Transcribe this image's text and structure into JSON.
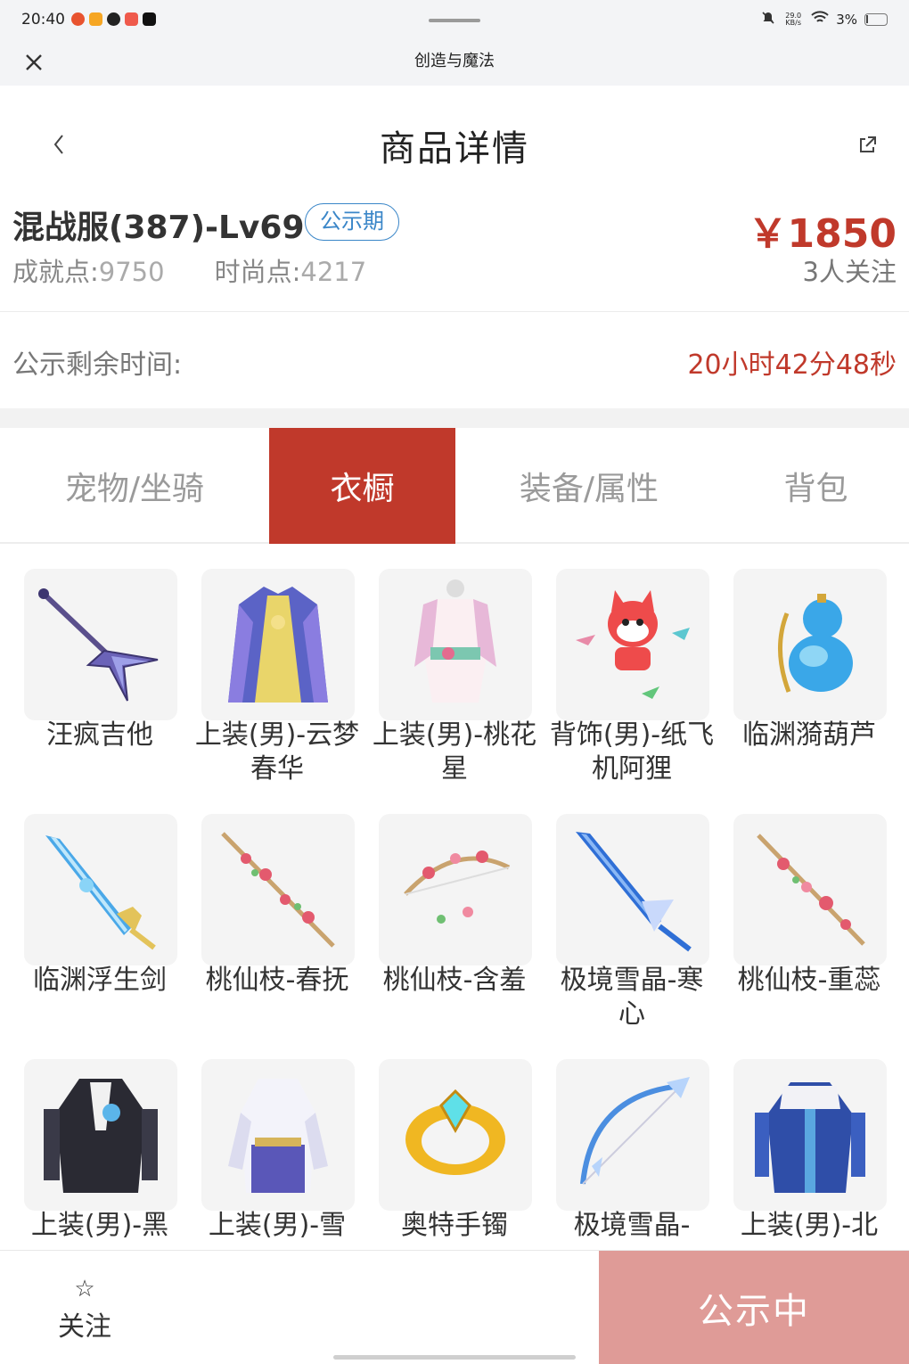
{
  "status_bar": {
    "time": "20:40",
    "net_speed": "29.0 KB/s",
    "battery": "3%"
  },
  "app_bar": {
    "title": "创造与魔法"
  },
  "header": {
    "title": "商品详情"
  },
  "product": {
    "name": "混战服(387)-Lv69",
    "badge": "公示期",
    "achievement_label": "成就点:",
    "achievement_value": "9750",
    "fashion_label": "时尚点:",
    "fashion_value": "4217",
    "price": "￥1850",
    "followers": "3人关注"
  },
  "countdown": {
    "label": "公示剩余时间:",
    "value": "20小时42分48秒"
  },
  "tabs": [
    {
      "label": "宠物/坐骑",
      "active": false
    },
    {
      "label": "衣橱",
      "active": true
    },
    {
      "label": "装备/属性",
      "active": false
    },
    {
      "label": "背包",
      "active": false
    }
  ],
  "items": [
    {
      "label": "汪疯吉他",
      "icon": "guitar-icon"
    },
    {
      "label": "上装(男)-云梦春华",
      "icon": "robe-icon"
    },
    {
      "label": "上装(男)-桃花星",
      "icon": "outfit-icon"
    },
    {
      "label": "背饰(男)-纸飞机阿狸",
      "icon": "fox-backpack-icon"
    },
    {
      "label": "临渊漪葫芦",
      "icon": "gourd-icon"
    },
    {
      "label": "临渊浮生剑",
      "icon": "sword-icon"
    },
    {
      "label": "桃仙枝-春抚",
      "icon": "branch-staff-icon"
    },
    {
      "label": "桃仙枝-含羞",
      "icon": "branch-bow-icon"
    },
    {
      "label": "极境雪晶-寒心",
      "icon": "ice-sword-icon"
    },
    {
      "label": "桃仙枝-重蕊",
      "icon": "branch-staff-icon"
    },
    {
      "label": "上装(男)-黑",
      "icon": "dark-coat-icon"
    },
    {
      "label": "上装(男)-雪",
      "icon": "white-robe-icon"
    },
    {
      "label": "奥特手镯",
      "icon": "bracelet-icon"
    },
    {
      "label": "极境雪晶-",
      "icon": "ice-bow-icon"
    },
    {
      "label": "上装(男)-北",
      "icon": "blue-coat-icon"
    }
  ],
  "colors": {
    "accent": "#c0392b",
    "badge_blue": "#3a86c8",
    "status_button": "#df9b97"
  },
  "bottom_bar": {
    "follow_label": "关注",
    "status_label": "公示中"
  }
}
